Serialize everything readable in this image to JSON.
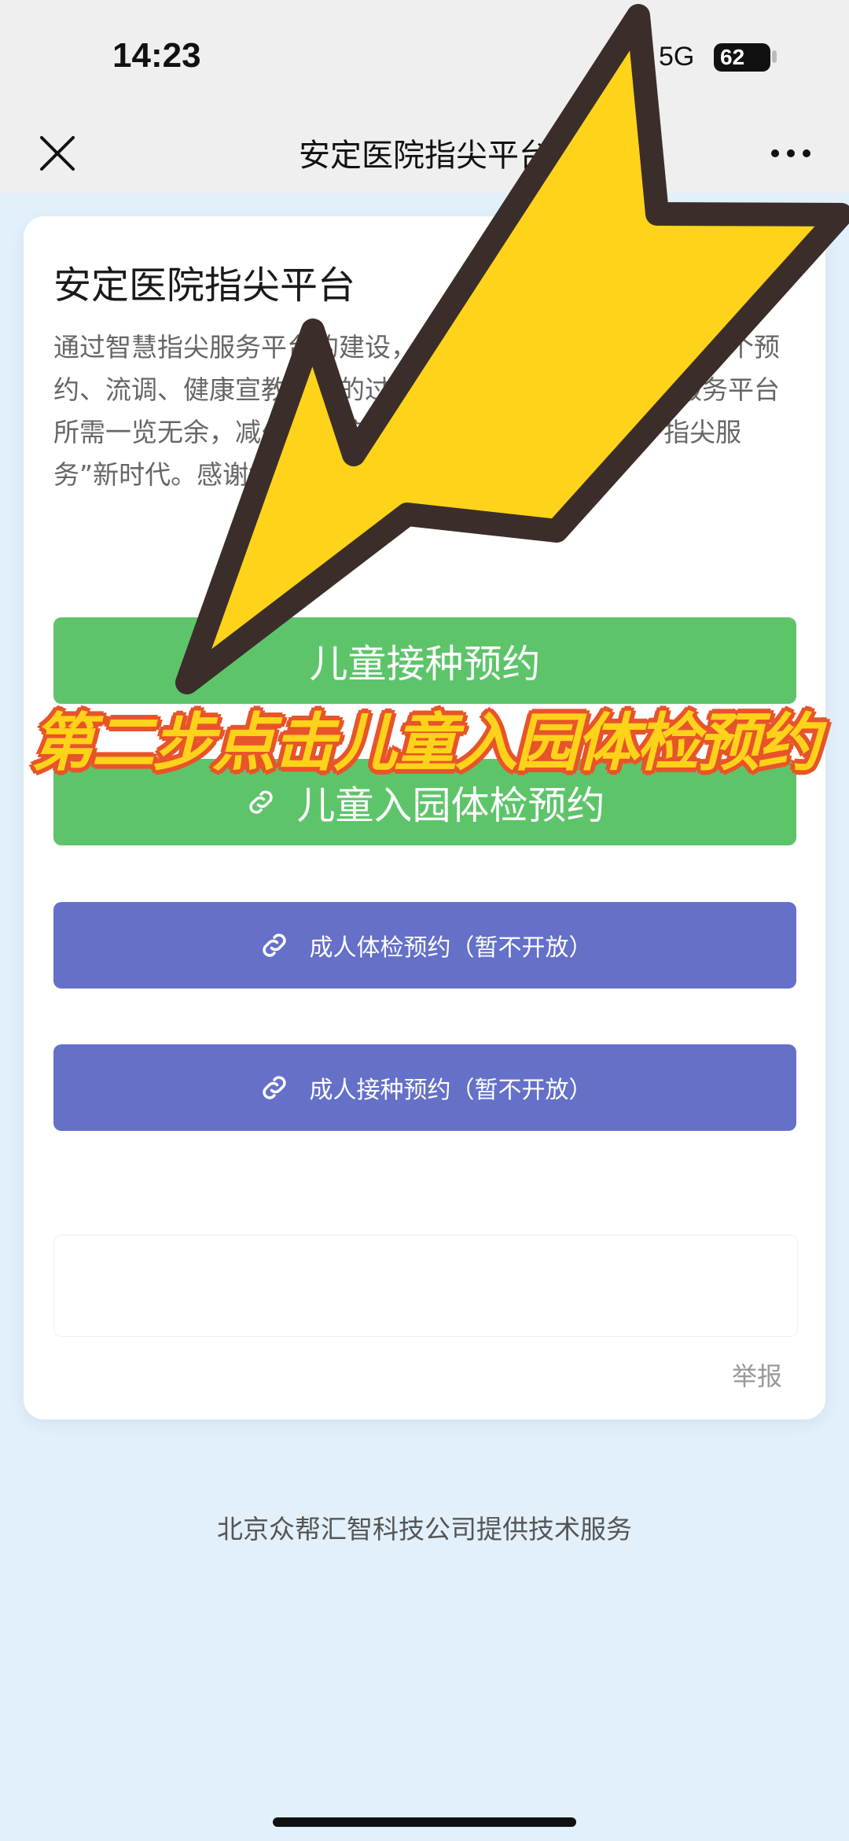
{
  "status_bar": {
    "time": "14:23",
    "network": "5G",
    "battery": "62"
  },
  "nav": {
    "title": "安定医院指尖平台"
  },
  "card": {
    "title": "安定医院指尖平台",
    "description": "通过智慧指尖服务平台的建设，您只需携带一部手机完成整个预约、流调、健康宣教签约的过程，实现了智能化。指尖服务平台所需一览无余，减少了到院排队的状态，让您真正进“指尖服务”新时代。感谢您的使用。",
    "buttons": [
      {
        "label": "儿童接种预约"
      },
      {
        "label": "儿童入园体检预约"
      },
      {
        "label": "成人体检预约（暂不开放）"
      },
      {
        "label": "成人接种预约（暂不开放）"
      }
    ],
    "report": "举报"
  },
  "footer": {
    "text": "北京众帮汇智科技公司提供技术服务"
  },
  "overlay": {
    "caption": "第二步点击儿童入园体检预约"
  },
  "colors": {
    "green": "#5ec46a",
    "blue": "#6570c9",
    "arrow": "#ffd319",
    "caption_outline": "#e8542a"
  }
}
